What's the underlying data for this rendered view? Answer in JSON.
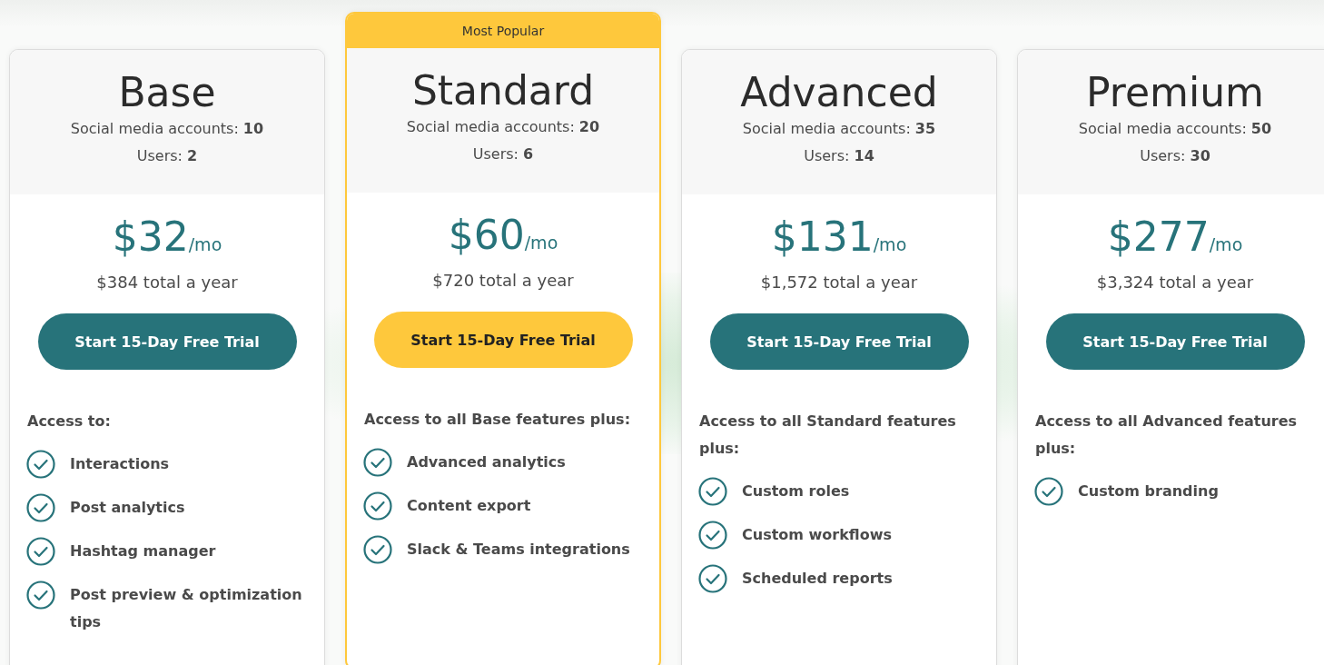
{
  "plans": [
    {
      "name": "Base",
      "featured": false,
      "accounts": "Social media accounts: **10**",
      "users": "Users: **2**",
      "price": "$32",
      "period": "/mo",
      "yearly": "$384 total a year",
      "cta": "Start 15-Day Free Trial",
      "intro": "Access to:",
      "features": [
        "Interactions",
        "Post analytics",
        "Hashtag manager",
        "Post preview & optimization tips"
      ]
    },
    {
      "name": "Standard",
      "featured": true,
      "badge": "Most Popular",
      "accounts": "Social media accounts: **20**",
      "users": "Users: **6**",
      "price": "$60",
      "period": "/mo",
      "yearly": "$720 total a year",
      "cta": "Start 15-Day Free Trial",
      "intro": "Access to all Base features plus:",
      "features": [
        "Advanced analytics",
        "Content export",
        "Slack & Teams integrations"
      ]
    },
    {
      "name": "Advanced",
      "featured": false,
      "accounts": "Social media accounts: **35**",
      "users": "Users: **14**",
      "price": "$131",
      "period": "/mo",
      "yearly": "$1,572 total a year",
      "cta": "Start 15-Day Free Trial",
      "intro": "Access to all Standard features plus:",
      "features": [
        "Custom roles",
        "Custom workflows",
        "Scheduled reports"
      ]
    },
    {
      "name": "Premium",
      "featured": false,
      "accounts": "Social media accounts: **50**",
      "users": "Users: **30**",
      "price": "$277",
      "period": "/mo",
      "yearly": "$3,324 total a year",
      "cta": "Start 15-Day Free Trial",
      "intro": "Access to all Advanced features plus:",
      "features": [
        "Custom branding"
      ]
    }
  ]
}
